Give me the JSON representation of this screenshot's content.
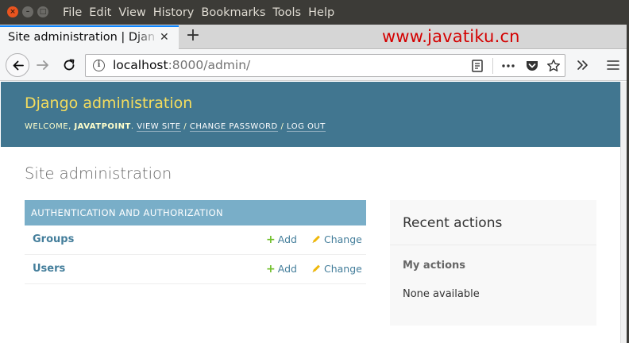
{
  "os_menubar": {
    "items": [
      "File",
      "Edit",
      "View",
      "History",
      "Bookmarks",
      "Tools",
      "Help"
    ]
  },
  "browser": {
    "tab_title": "Site administration | Django",
    "watermark": "www.javatiku.cn",
    "url_host": "localhost",
    "url_rest": ":8000/admin/"
  },
  "header": {
    "branding": "Django administration",
    "welcome": "WELCOME,",
    "username": "JAVATPOINT",
    "view_site": "VIEW SITE",
    "change_password": "CHANGE PASSWORD",
    "log_out": "LOG OUT"
  },
  "content": {
    "title": "Site administration",
    "app_module": {
      "caption": "AUTHENTICATION AND AUTHORIZATION",
      "models": [
        {
          "name": "Groups",
          "add": "Add",
          "change": "Change"
        },
        {
          "name": "Users",
          "add": "Add",
          "change": "Change"
        }
      ]
    }
  },
  "recent_actions": {
    "title": "Recent actions",
    "subtitle": "My actions",
    "empty": "None available"
  },
  "colors": {
    "header_bg": "#417690",
    "branding": "#f5dd5d",
    "caption_bg": "#79aec8",
    "link": "#447e9b",
    "add_icon": "#70bf2b",
    "change_icon": "#efb80b"
  }
}
